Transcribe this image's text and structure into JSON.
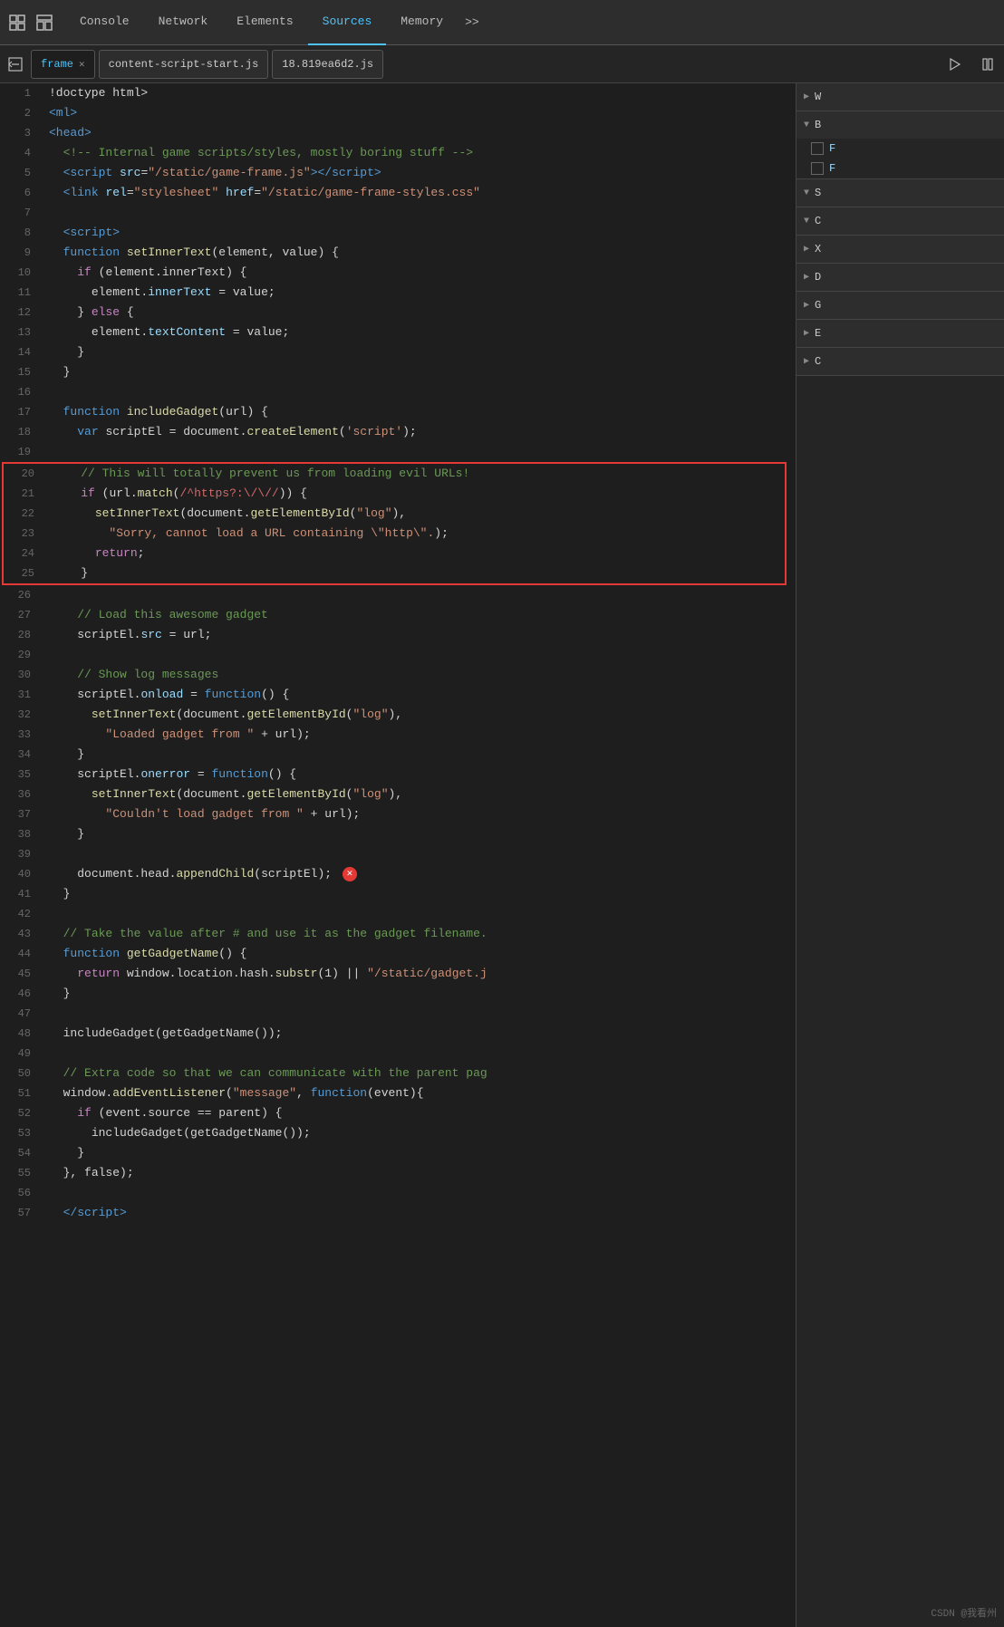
{
  "tabs": {
    "devtools": [
      {
        "label": "Console",
        "active": false
      },
      {
        "label": "Network",
        "active": false
      },
      {
        "label": "Elements",
        "active": false
      },
      {
        "label": "Sources",
        "active": true
      },
      {
        "label": "Memory",
        "active": false
      },
      {
        "label": ">>",
        "active": false
      }
    ]
  },
  "file_tabs": [
    {
      "label": "frame",
      "closable": true,
      "active": true
    },
    {
      "label": "content-script-start.js",
      "closable": false,
      "active": false
    },
    {
      "label": "18.819ea6d2.js",
      "closable": false,
      "active": false
    }
  ],
  "sidebar_sections": [
    {
      "label": "W",
      "expanded": true,
      "arrow": "▶"
    },
    {
      "label": "B",
      "expanded": true,
      "arrow": "▼"
    },
    {
      "items": [
        "F",
        "F"
      ],
      "checkboxes": true
    },
    {
      "label": "S",
      "expanded": true,
      "arrow": "▼"
    },
    {
      "label": "C",
      "expanded": true,
      "arrow": "▼"
    },
    {
      "label": "X",
      "expanded": false,
      "arrow": "▶"
    },
    {
      "label": "D",
      "expanded": false,
      "arrow": "▶"
    },
    {
      "label": "G",
      "expanded": false,
      "arrow": "▶"
    },
    {
      "label": "E",
      "expanded": false,
      "arrow": "▶"
    },
    {
      "label": "C",
      "expanded": false,
      "arrow": "▶"
    }
  ],
  "watermark": "CSDN @我看州",
  "code": [
    {
      "n": 1,
      "html": "<span class='plain'>!doctype html&gt;</span>"
    },
    {
      "n": 2,
      "html": "<span class='tag'>&lt;ml&gt;</span>"
    },
    {
      "n": 3,
      "html": "<span class='tag'>&lt;head&gt;</span>"
    },
    {
      "n": 4,
      "html": "  <span class='cmt'>&lt;!-- Internal game scripts/styles, mostly boring stuff --&gt;</span>"
    },
    {
      "n": 5,
      "html": "  <span class='tag'>&lt;script</span> <span class='attr'>src</span>=<span class='str'>\"/static/game-frame.js\"</span><span class='tag'>&gt;&lt;/script&gt;</span>"
    },
    {
      "n": 6,
      "html": "  <span class='tag'>&lt;link</span> <span class='attr'>rel</span>=<span class='str'>\"stylesheet\"</span> <span class='attr'>href</span>=<span class='str'>\"/static/game-frame-styles.css\"</span>"
    },
    {
      "n": 7,
      "html": ""
    },
    {
      "n": 8,
      "html": "  <span class='tag'>&lt;script&gt;</span>"
    },
    {
      "n": 9,
      "html": "  <span class='kw'>function</span> <span class='fn'>setInnerText</span><span class='plain'>(element, value) {</span>"
    },
    {
      "n": 10,
      "html": "    <span class='kw2'>if</span> <span class='plain'>(element.innerText) {</span>"
    },
    {
      "n": 11,
      "html": "      <span class='plain'>element.</span><span class='prop'>innerText</span> <span class='plain'>= value;</span>"
    },
    {
      "n": 12,
      "html": "    <span class='plain'>} </span><span class='kw2'>else</span> <span class='plain'>{</span>"
    },
    {
      "n": 13,
      "html": "      <span class='plain'>element.</span><span class='prop'>textContent</span> <span class='plain'>= value;</span>"
    },
    {
      "n": 14,
      "html": "    <span class='plain'>}</span>"
    },
    {
      "n": 15,
      "html": "  <span class='plain'>}</span>"
    },
    {
      "n": 16,
      "html": ""
    },
    {
      "n": 17,
      "html": "  <span class='kw'>function</span> <span class='fn'>includeGadget</span><span class='plain'>(url) {</span>"
    },
    {
      "n": 18,
      "html": "    <span class='kw'>var</span> <span class='plain'>scriptEl = document.</span><span class='fn'>createElement</span><span class='plain'>(</span><span class='str'>'script'</span><span class='plain'>);</span>"
    },
    {
      "n": 19,
      "html": ""
    },
    {
      "n": 20,
      "html": "    <span class='cmt'>// This will totally prevent us from loading evil URLs!</span>",
      "highlight": true
    },
    {
      "n": 21,
      "html": "    <span class='kw2'>if</span> <span class='plain'>(url.</span><span class='fn'>match</span><span class='plain'>(</span><span class='regex'>/^https?:\\/\\//</span><span class='plain'>)) {</span>",
      "highlight": true
    },
    {
      "n": 22,
      "html": "      <span class='fn'>setInnerText</span><span class='plain'>(document.</span><span class='fn'>getElementById</span><span class='plain'>(</span><span class='str'>\"log\"</span><span class='plain'>),</span>",
      "highlight": true
    },
    {
      "n": 23,
      "html": "        <span class='str'>\"Sorry, cannot load a URL containing \\\"http\\\".</span><span class='plain\">\"</span><span class='plain'>);</span>",
      "highlight": true
    },
    {
      "n": 24,
      "html": "      <span class='kw2'>return</span><span class='plain'>;</span>",
      "highlight": true
    },
    {
      "n": 25,
      "html": "    <span class='plain'>}</span>",
      "highlight": true
    },
    {
      "n": 26,
      "html": ""
    },
    {
      "n": 27,
      "html": "    <span class='cmt'>// Load this awesome gadget</span>"
    },
    {
      "n": 28,
      "html": "    <span class='plain'>scriptEl.</span><span class='prop'>src</span> <span class='plain'>= url;</span>"
    },
    {
      "n": 29,
      "html": ""
    },
    {
      "n": 30,
      "html": "    <span class='cmt'>// Show log messages</span>"
    },
    {
      "n": 31,
      "html": "    <span class='plain'>scriptEl.</span><span class='prop'>onload</span> <span class='plain'>= </span><span class='kw'>function</span><span class='plain'>() {</span>"
    },
    {
      "n": 32,
      "html": "      <span class='fn'>setInnerText</span><span class='plain'>(document.</span><span class='fn'>getElementById</span><span class='plain'>(</span><span class='str'>\"log\"</span><span class='plain'>),</span>"
    },
    {
      "n": 33,
      "html": "        <span class='str'>\"Loaded gadget from \"</span> <span class='plain'>+ url);</span>"
    },
    {
      "n": 34,
      "html": "    <span class='plain'>}</span>"
    },
    {
      "n": 35,
      "html": "    <span class='plain'>scriptEl.</span><span class='prop'>onerror</span> <span class='plain'>= </span><span class='kw'>function</span><span class='plain'>() {</span>"
    },
    {
      "n": 36,
      "html": "      <span class='fn'>setInnerText</span><span class='plain'>(document.</span><span class='fn'>getElementById</span><span class='plain'>(</span><span class='str'>\"log\"</span><span class='plain'>),</span>"
    },
    {
      "n": 37,
      "html": "        <span class='str'>\"Couldn't load gadget from \"</span> <span class='plain'>+ url);</span>"
    },
    {
      "n": 38,
      "html": "    <span class='plain'>}</span>"
    },
    {
      "n": 39,
      "html": ""
    },
    {
      "n": 40,
      "html": "    <span class='plain'>document.head.</span><span class='fn'>appendChild</span><span class='plain'>(scriptEl);</span>",
      "error": true
    },
    {
      "n": 41,
      "html": "  <span class='plain'>}</span>"
    },
    {
      "n": 42,
      "html": ""
    },
    {
      "n": 43,
      "html": "  <span class='cmt'>// Take the value after # and use it as the gadget filename.</span>"
    },
    {
      "n": 44,
      "html": "  <span class='kw'>function</span> <span class='fn'>getGadgetName</span><span class='plain'>() {</span>"
    },
    {
      "n": 45,
      "html": "    <span class='kw2'>return</span> <span class='plain'>window.location.hash.</span><span class='fn'>substr</span><span class='plain'>(1) || </span><span class='str'>\"/static/gadget.j</span>"
    },
    {
      "n": 46,
      "html": "  <span class='plain'>}</span>"
    },
    {
      "n": 47,
      "html": ""
    },
    {
      "n": 48,
      "html": "  <span class='plain'>includeGadget(getGadgetName());</span>"
    },
    {
      "n": 49,
      "html": ""
    },
    {
      "n": 50,
      "html": "  <span class='cmt'>// Extra code so that we can communicate with the parent pag</span>"
    },
    {
      "n": 51,
      "html": "  <span class='plain'>window.</span><span class='fn'>addEventListener</span><span class='plain'>(</span><span class='str'>\"message\"</span><span class='plain'>, </span><span class='kw'>function</span><span class='plain'>(event){</span>"
    },
    {
      "n": 52,
      "html": "    <span class='kw2'>if</span> <span class='plain'>(event.source == parent) {</span>"
    },
    {
      "n": 53,
      "html": "      <span class='plain'>includeGadget(getGadgetName());</span>"
    },
    {
      "n": 54,
      "html": "    <span class='plain'>}</span>"
    },
    {
      "n": 55,
      "html": "  <span class='plain'>}, false);</span>"
    },
    {
      "n": 56,
      "html": ""
    },
    {
      "n": 57,
      "html": "  <span class='tag'>&lt;/script&gt;</span>"
    }
  ]
}
